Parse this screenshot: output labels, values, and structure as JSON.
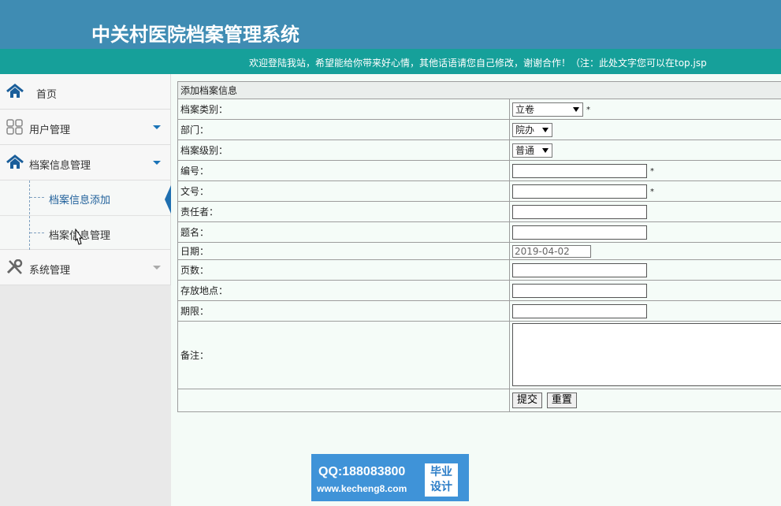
{
  "header": {
    "title": "中关村医院档案管理系统"
  },
  "marquee": {
    "text": "欢迎登陆我站，希望能给你带来好心情，其他话语请您自己修改，谢谢合作！（注：此处文字您可以在top.jsp"
  },
  "sidebar": {
    "items": [
      {
        "label": "首页",
        "icon": "home-icon"
      },
      {
        "label": "用户管理",
        "icon": "grid-icon"
      },
      {
        "label": "档案信息管理",
        "icon": "home-icon"
      },
      {
        "label": "系统管理",
        "icon": "wrench-icon"
      }
    ],
    "sub_items": [
      {
        "label": "档案信息添加"
      },
      {
        "label": "档案信息管理"
      }
    ]
  },
  "form": {
    "header": "添加档案信息",
    "fields": {
      "category": {
        "label": "档案类别：",
        "value": "立卷"
      },
      "department": {
        "label": "部门：",
        "value": "院办"
      },
      "level": {
        "label": "档案级别：",
        "value": "普通"
      },
      "number": {
        "label": "编号：",
        "value": ""
      },
      "doc_no": {
        "label": "文号：",
        "value": ""
      },
      "owner": {
        "label": "责任者：",
        "value": ""
      },
      "title": {
        "label": "题名：",
        "value": ""
      },
      "date": {
        "label": "日期：",
        "value": "2019-04-02"
      },
      "pages": {
        "label": "页数：",
        "value": ""
      },
      "location": {
        "label": "存放地点：",
        "value": ""
      },
      "term": {
        "label": "期限：",
        "value": ""
      },
      "remarks": {
        "label": "备注：",
        "value": ""
      }
    },
    "required_mark": "*",
    "submit_label": "提交",
    "reset_label": "重置"
  },
  "watermark": {
    "qq": "QQ:188083800",
    "url": "www.kecheng8.com",
    "badge_line1": "毕业",
    "badge_line2": "设计"
  },
  "colors": {
    "header_bg": "#3f8cb3",
    "marquee_bg": "#16a09a",
    "accent": "#1a73b7",
    "watermark_bg": "#3f93d8"
  }
}
